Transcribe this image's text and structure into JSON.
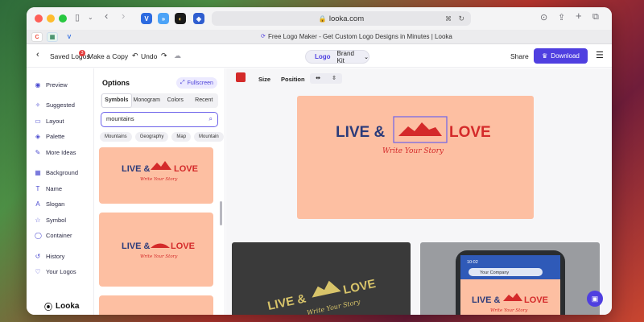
{
  "colors": {
    "accent": "#4f3fe0",
    "logo_navy": "#2b3b7a",
    "logo_red": "#d42a2a",
    "canvas_peach": "#fdbfa2",
    "selected_color": "#d42a2a"
  },
  "browser": {
    "url": "looka.com",
    "tab_title": "Free Logo Maker - Get Custom Logo Designs in Minutes | Looka"
  },
  "toolbar": {
    "saved_logos": "Saved Logos",
    "saved_badge": "3",
    "make_copy": "Make a Copy",
    "undo": "Undo",
    "segment_logo": "Logo",
    "segment_brand_kit": "Brand Kit",
    "share": "Share",
    "download": "Download"
  },
  "sidebar": {
    "items": [
      {
        "label": "Preview",
        "icon": "eye-icon"
      },
      {
        "label": "Suggested",
        "icon": "sparkle-icon"
      },
      {
        "label": "Layout",
        "icon": "layout-icon"
      },
      {
        "label": "Palette",
        "icon": "palette-icon"
      },
      {
        "label": "More Ideas",
        "icon": "wand-icon"
      },
      {
        "label": "Background",
        "icon": "background-icon"
      },
      {
        "label": "Name",
        "icon": "text-icon"
      },
      {
        "label": "Slogan",
        "icon": "slogan-icon"
      },
      {
        "label": "Symbol",
        "icon": "star-icon"
      },
      {
        "label": "Container",
        "icon": "container-icon"
      },
      {
        "label": "History",
        "icon": "history-icon"
      },
      {
        "label": "Your Logos",
        "icon": "heart-icon"
      }
    ],
    "brand": "Looka"
  },
  "options": {
    "title": "Options",
    "fullscreen": "Fullscreen",
    "tabs": [
      "Symbols",
      "Monogram",
      "Colors",
      "Recent"
    ],
    "active_tab": "Symbols",
    "search_value": "mountains",
    "chips": [
      "Mountains",
      "Geography",
      "Map",
      "Mountain"
    ]
  },
  "logo": {
    "name_left": "LIVE &",
    "name_right": "LOVE",
    "slogan": "Write Your Story"
  },
  "editor": {
    "size": "Size",
    "position": "Position"
  },
  "mockup": {
    "company_placeholder": "Your Company",
    "phone_time": "10:02"
  }
}
